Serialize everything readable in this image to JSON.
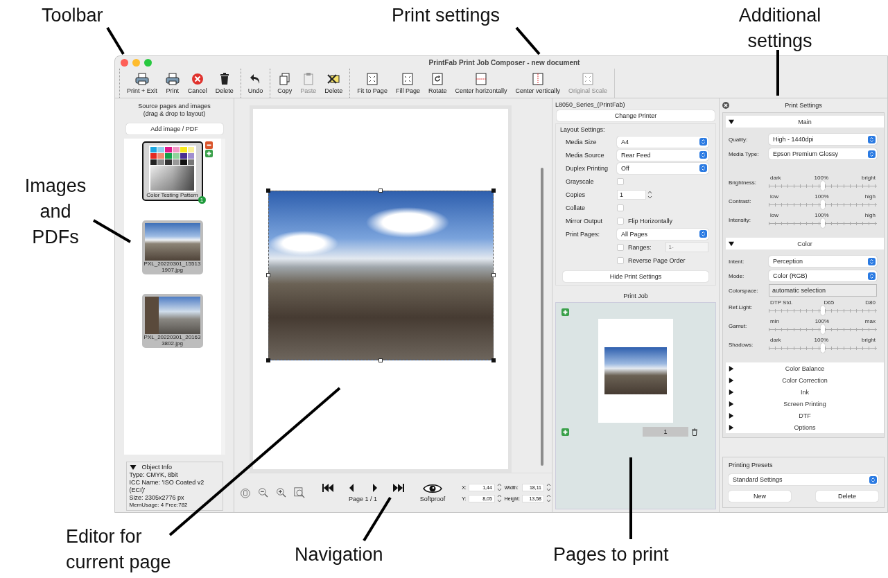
{
  "annotations": [
    {
      "text": "Toolbar"
    },
    {
      "text": "Print settings"
    },
    {
      "text": "Additional settings"
    },
    {
      "text": "Images and PDFs"
    },
    {
      "text": "Editor for current page"
    },
    {
      "text": "Navigation"
    },
    {
      "text": "Pages to print"
    }
  ],
  "window": {
    "title": "PrintFab Print Job Composer - new document"
  },
  "toolbar": {
    "groups": [
      [
        {
          "kind": "print-exit",
          "label": "Print + Exit",
          "disabled": false
        },
        {
          "kind": "print",
          "label": "Print",
          "disabled": false
        },
        {
          "kind": "cancel",
          "label": "Cancel",
          "disabled": false
        },
        {
          "kind": "trash",
          "label": "Delete",
          "disabled": false
        }
      ],
      [
        {
          "kind": "undo",
          "label": "Undo",
          "disabled": false
        }
      ],
      [
        {
          "kind": "copy",
          "label": "Copy",
          "disabled": false
        },
        {
          "kind": "paste",
          "label": "Paste",
          "disabled": true
        },
        {
          "kind": "delete-x",
          "label": "Delete",
          "disabled": false
        }
      ],
      [
        {
          "kind": "fit",
          "label": "Fit to Page",
          "disabled": false
        },
        {
          "kind": "fill",
          "label": "Fill Page",
          "disabled": false
        },
        {
          "kind": "rotate",
          "label": "Rotate",
          "disabled": false
        },
        {
          "kind": "center-h",
          "label": "Center horizontally",
          "disabled": false
        },
        {
          "kind": "center-v",
          "label": "Center vertically",
          "disabled": false
        },
        {
          "kind": "original",
          "label": "Original Scale",
          "disabled": true
        }
      ]
    ]
  },
  "source_panel": {
    "heading": "Source pages and images\n(drag & drop to layout)",
    "add_button": "Add image / PDF",
    "thumbnails": [
      {
        "kind": "test-chart",
        "caption": "Color Testing Pattern",
        "selected": true,
        "badge": "1"
      },
      {
        "kind": "photo",
        "caption": "PXL_20220301_155131907.jpg",
        "selected": false
      },
      {
        "kind": "photo",
        "caption": "PXL_20220301_201633802.jpg",
        "selected": false
      }
    ],
    "object_info": {
      "title": "Object Info",
      "expanded": true,
      "lines": [
        "Type: CMYK, 8bit",
        "ICC Name: 'ISO Coated v2 (ECI)'",
        "Size: 2305x2776 px"
      ],
      "memory": "MemUsage: 4 Free:782"
    }
  },
  "editor": {
    "page_label": "Page 1 / 1",
    "softproof": "Softproof",
    "fields": [
      {
        "label": "X:",
        "value": "1,44"
      },
      {
        "label": "Width:",
        "value": "18,11"
      },
      {
        "label": "Y:",
        "value": "8,05"
      },
      {
        "label": "Height:",
        "value": "13,58"
      }
    ]
  },
  "print_settings": {
    "printer": "L8050_Series_(PrintFab)",
    "change_button": "Change Printer",
    "section_title": "Layout Settings:",
    "rows": [
      {
        "kind": "select",
        "label": "Media Size",
        "value": "A4"
      },
      {
        "kind": "select",
        "label": "Media Source",
        "value": "Rear Feed"
      },
      {
        "kind": "select",
        "label": "Duplex Printing",
        "value": "Off"
      },
      {
        "kind": "checkbox",
        "label": "Grayscale",
        "checked": false
      },
      {
        "kind": "spin",
        "label": "Copies",
        "value": "1"
      },
      {
        "kind": "checkbox",
        "label": "Collate",
        "checked": false
      },
      {
        "kind": "checkbox",
        "label": "Mirror Output",
        "option": "Flip Horizontally",
        "checked": false
      },
      {
        "kind": "select",
        "label": "Print Pages:",
        "value": "All Pages"
      },
      {
        "kind": "range",
        "option": "Ranges:",
        "placeholder": "1-",
        "checked": false
      },
      {
        "kind": "checkbox",
        "option": "Reverse Page Order",
        "checked": false
      }
    ],
    "hide_button": "Hide Print Settings"
  },
  "print_job": {
    "title": "Print Job",
    "page_number": "1"
  },
  "additional_settings": {
    "title": "Print Settings",
    "sections": [
      {
        "title": "Main",
        "expanded": true,
        "items": [
          {
            "kind": "select",
            "label": "Quality:",
            "value": "High - 1440dpi"
          },
          {
            "kind": "select",
            "label": "Media Type:",
            "value": "Epson Premium Glossy"
          },
          {
            "kind": "slider",
            "label": "Brightness:",
            "min": "dark",
            "mid": "100%",
            "max": "bright",
            "level": 0.5
          },
          {
            "kind": "slider",
            "label": "Contrast:",
            "min": "low",
            "mid": "100%",
            "max": "high",
            "level": 0.5
          },
          {
            "kind": "slider",
            "label": "Intensity:",
            "min": "low",
            "mid": "100%",
            "max": "high",
            "level": 0.5
          }
        ]
      },
      {
        "title": "Color",
        "expanded": true,
        "items": [
          {
            "kind": "select",
            "label": "Intent:",
            "value": "Perception"
          },
          {
            "kind": "select",
            "label": "Mode:",
            "value": "Color (RGB)"
          },
          {
            "kind": "field",
            "label": "Colorspace:",
            "value": "automatic selection"
          },
          {
            "kind": "slider",
            "label": "Ref.Light:",
            "min": "DTP Std.",
            "mid": "D65",
            "max": "D80",
            "level": 0.5
          },
          {
            "kind": "slider",
            "label": "Gamut:",
            "min": "min",
            "mid": "100%",
            "max": "max",
            "level": 0.5
          },
          {
            "kind": "slider",
            "label": "Shadows:",
            "min": "dark",
            "mid": "100%",
            "max": "bright",
            "level": 0.5
          }
        ]
      },
      {
        "title": "Color Balance",
        "expanded": false
      },
      {
        "title": "Color Correction",
        "expanded": false
      },
      {
        "title": "Ink",
        "expanded": false
      },
      {
        "title": "Screen Printing",
        "expanded": false
      },
      {
        "title": "DTF",
        "expanded": false
      },
      {
        "title": "Options",
        "expanded": false
      }
    ]
  },
  "presets": {
    "title": "Printing Presets",
    "value": "Standard Settings",
    "buttons": [
      "New",
      "Delete"
    ]
  }
}
